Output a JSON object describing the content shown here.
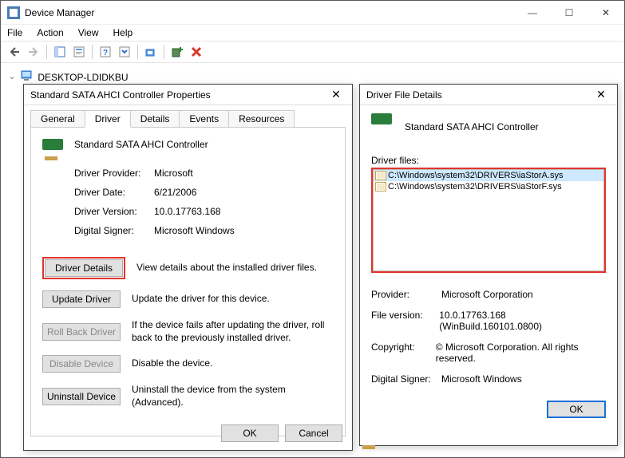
{
  "window": {
    "title": "Device Manager",
    "menus": [
      "File",
      "Action",
      "View",
      "Help"
    ],
    "computer_name": "DESKTOP-LDIDKBU"
  },
  "props": {
    "title": "Standard SATA AHCI Controller Properties",
    "tabs": [
      "General",
      "Driver",
      "Details",
      "Events",
      "Resources"
    ],
    "active_tab": "Driver",
    "device_name": "Standard SATA AHCI Controller",
    "fields": {
      "provider_label": "Driver Provider:",
      "provider_value": "Microsoft",
      "date_label": "Driver Date:",
      "date_value": "6/21/2006",
      "version_label": "Driver Version:",
      "version_value": "10.0.17763.168",
      "signer_label": "Digital Signer:",
      "signer_value": "Microsoft Windows"
    },
    "buttons": {
      "details": "Driver Details",
      "details_desc": "View details about the installed driver files.",
      "update": "Update Driver",
      "update_desc": "Update the driver for this device.",
      "rollback": "Roll Back Driver",
      "rollback_desc": "If the device fails after updating the driver, roll back to the previously installed driver.",
      "disable": "Disable Device",
      "disable_desc": "Disable the device.",
      "uninstall": "Uninstall Device",
      "uninstall_desc": "Uninstall the device from the system (Advanced)."
    },
    "footer": {
      "ok": "OK",
      "cancel": "Cancel"
    }
  },
  "details": {
    "title": "Driver File Details",
    "device_name": "Standard SATA AHCI Controller",
    "files_label": "Driver files:",
    "files": [
      "C:\\Windows\\system32\\DRIVERS\\iaStorA.sys",
      "C:\\Windows\\system32\\DRIVERS\\iaStorF.sys"
    ],
    "info": {
      "provider_label": "Provider:",
      "provider_value": "Microsoft Corporation",
      "filever_label": "File version:",
      "filever_value": "10.0.17763.168 (WinBuild.160101.0800)",
      "copyright_label": "Copyright:",
      "copyright_value": "© Microsoft Corporation. All rights reserved.",
      "signer_label": "Digital Signer:",
      "signer_value": "Microsoft Windows"
    },
    "ok": "OK"
  }
}
